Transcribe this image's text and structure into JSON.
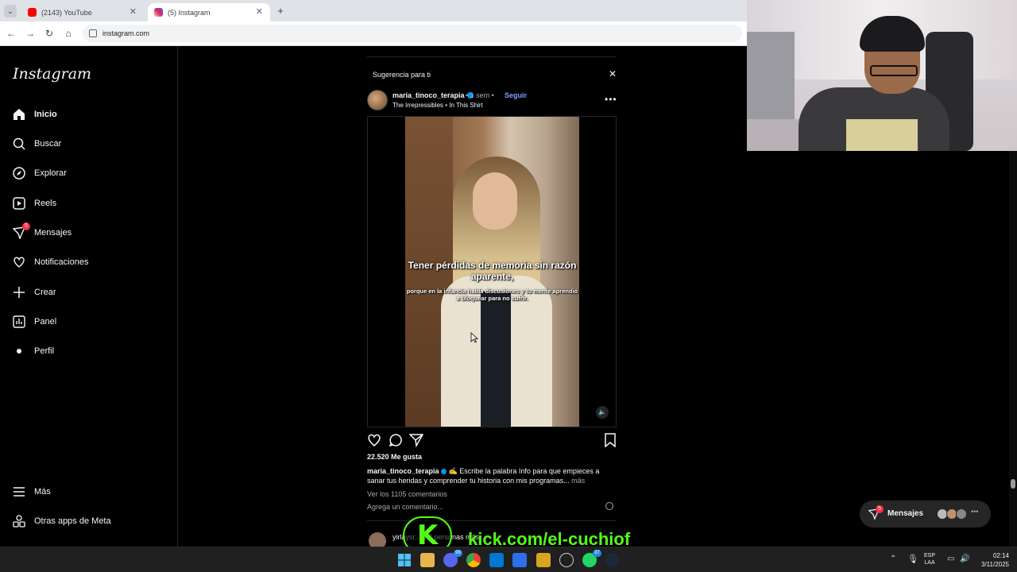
{
  "browser": {
    "tabs": [
      {
        "label": "(2143) YouTube",
        "favicon": "youtube-icon",
        "color": "#ff0000"
      },
      {
        "label": "(5) Instagram",
        "favicon": "instagram-icon",
        "color": "#d62976"
      }
    ],
    "url": "instagram.com"
  },
  "sidebar": {
    "logo": "Instagram",
    "items": [
      {
        "label": "Inicio",
        "icon": "home-icon"
      },
      {
        "label": "Buscar",
        "icon": "search-icon"
      },
      {
        "label": "Explorar",
        "icon": "compass-icon"
      },
      {
        "label": "Reels",
        "icon": "reels-icon"
      },
      {
        "label": "Mensajes",
        "icon": "messenger-icon",
        "badge": "5"
      },
      {
        "label": "Notificaciones",
        "icon": "heart-icon"
      },
      {
        "label": "Crear",
        "icon": "plus-icon"
      },
      {
        "label": "Panel",
        "icon": "chart-icon"
      },
      {
        "label": "Perfil",
        "icon": "profile-icon"
      }
    ],
    "bottom": [
      {
        "label": "Más",
        "icon": "menu-icon"
      },
      {
        "label": "Otras apps de Meta",
        "icon": "meta-apps-icon"
      }
    ]
  },
  "post": {
    "suggestion": "Sugerencia para ti",
    "username": "maria_tinoco_terapia",
    "time": "• 1 sem •",
    "follow": "Seguir",
    "audio": "The Irrepressibles • In This Shirt",
    "video_caption_main": "Tener pérdidas de memoria sin razón aparente,",
    "video_caption_sub": "porque en la infancia había discusiones y tu mente aprendió a bloquear para no sufrir.",
    "likes": "22.520 Me gusta",
    "caption_user": "maria_tinoco_terapia",
    "caption_text": "✍️ Escribe la palabra Info para que empieces a sanar tus heridas y comprender tu historia con mis programas...",
    "caption_more": "más",
    "comments_link": "Ver los 1105 comentarios",
    "add_comment": "Agrega un comentario...",
    "next_user": "yirlaysr... y 3 personas más"
  },
  "messages_pill": {
    "label": "Mensajes",
    "badge": "5"
  },
  "overlay": {
    "kick_letter": "K",
    "kick_url": "kick.com/el-cuchiof"
  },
  "taskbar": {
    "lang_line1": "ESP",
    "lang_line2": "LAA",
    "time": "02:14",
    "date": "3/11/2025",
    "badges": {
      "discord": "99",
      "whatsapp": "37"
    }
  },
  "colors": {
    "accent": "#0095f6",
    "follow": "#85a0ff",
    "notification": "#ff3040",
    "kick_green": "#53fc18"
  }
}
